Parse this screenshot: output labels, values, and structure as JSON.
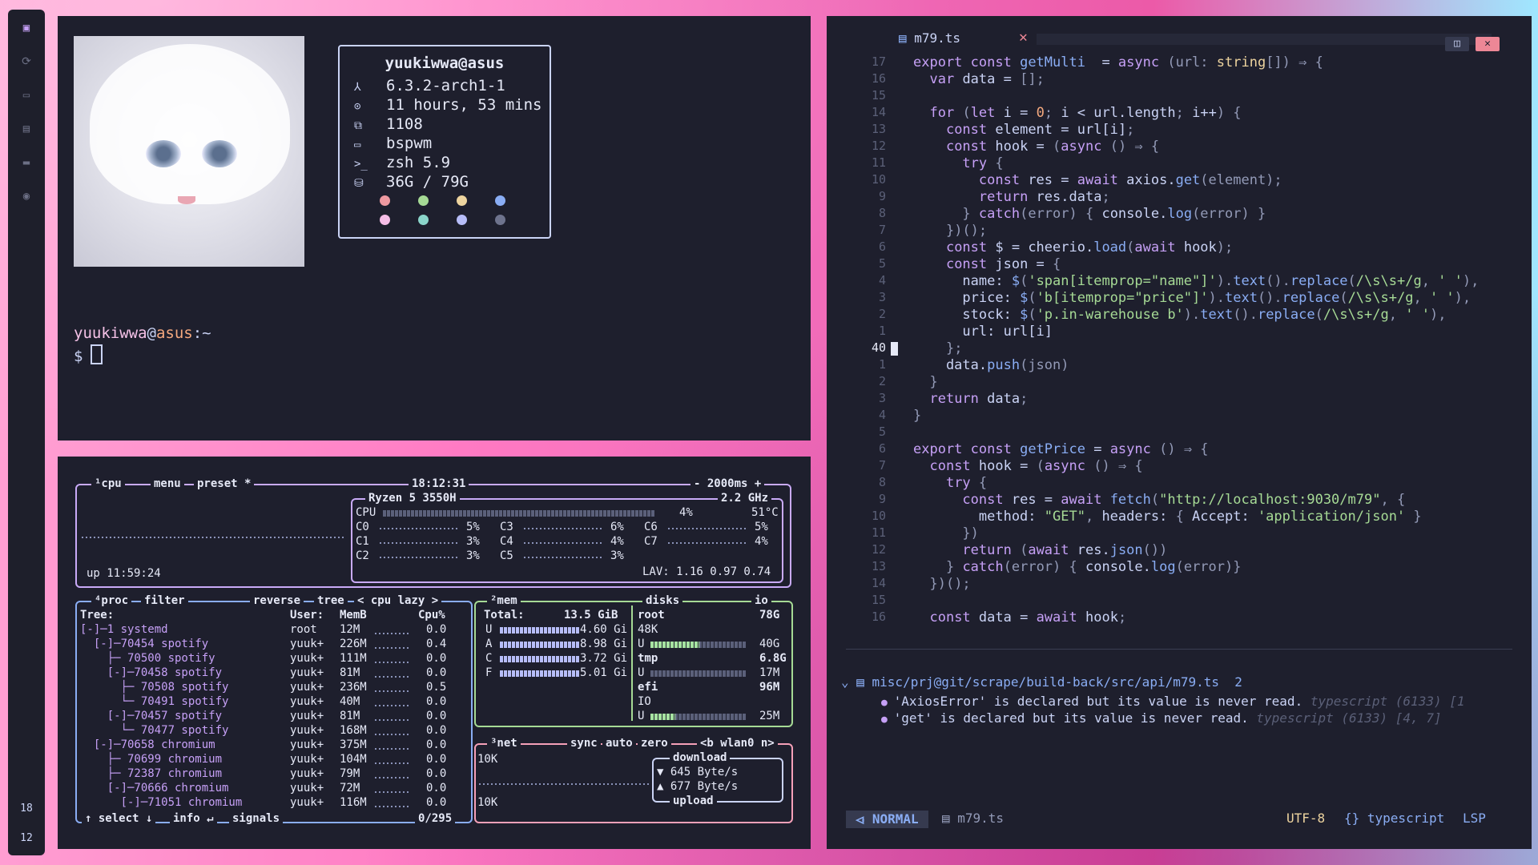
{
  "dock": {
    "workspace_top": "18",
    "workspace_bottom": "12"
  },
  "terminal": {
    "fetch_user": "yuukiwwa@asus",
    "fetch_rows": [
      {
        "icon": "arch-icon",
        "glyph": "⅄",
        "value": "6.3.2-arch1-1"
      },
      {
        "icon": "clock-icon",
        "glyph": "⊙",
        "value": "11 hours, 53 mins"
      },
      {
        "icon": "package-icon",
        "glyph": "⧉",
        "value": "1108"
      },
      {
        "icon": "window-icon",
        "glyph": "▭",
        "value": "bspwm"
      },
      {
        "icon": "shell-icon",
        "glyph": ">_",
        "value": "zsh 5.9"
      },
      {
        "icon": "disk-icon",
        "glyph": "⛁",
        "value": "36G / 79G"
      }
    ],
    "palette": [
      "#ee99a0",
      "#a6da95",
      "#eed49f",
      "#8aadf4",
      "#f5bde6",
      "#8bd5ca",
      "#b7bdf8",
      "#6e738d"
    ],
    "prompt_user": "yuukiwwa",
    "prompt_at": "@",
    "prompt_host": "asus",
    "prompt_path": ":~",
    "prompt_symbol": "$"
  },
  "btop": {
    "cpu_box": {
      "tab_cpu": "¹cpu",
      "menu": "menu",
      "preset": "preset *",
      "clock": "18:12:31",
      "interval": "- 2000ms +",
      "model": "Ryzen 5 3550H",
      "freq": "2.2 GHz",
      "uptime": "up 11:59:24",
      "cpu_total": {
        "label": "CPU",
        "pct": "4%",
        "temp": "51°C"
      },
      "cores": [
        {
          "name": "C0",
          "pct": "5%"
        },
        {
          "name": "C3",
          "pct": "6%"
        },
        {
          "name": "C6",
          "pct": "5%"
        },
        {
          "name": "C1",
          "pct": "3%"
        },
        {
          "name": "C4",
          "pct": "4%"
        },
        {
          "name": "C7",
          "pct": "4%"
        },
        {
          "name": "C2",
          "pct": "3%"
        },
        {
          "name": "C5",
          "pct": "3%"
        }
      ],
      "lav": "LAV: 1.16 0.97 0.74"
    },
    "proc": {
      "header_tabs": "⁴proc",
      "filter": "filter",
      "reverse": "reverse",
      "tree": "tree",
      "cpu_lazy": "< cpu lazy >",
      "columns": [
        "Tree:",
        "User:",
        "MemB",
        "Cpu%"
      ],
      "rows": [
        {
          "tree": "[-]─1 systemd",
          "user": "root",
          "mem": "12M",
          "cpu": "0.0"
        },
        {
          "tree": "  [-]─70454 spotify",
          "user": "yuuk+",
          "mem": "226M",
          "cpu": "0.4"
        },
        {
          "tree": "    ├─ 70500 spotify",
          "user": "yuuk+",
          "mem": "111M",
          "cpu": "0.0"
        },
        {
          "tree": "    [-]─70458 spotify",
          "user": "yuuk+",
          "mem": "81M",
          "cpu": "0.0"
        },
        {
          "tree": "      ├─ 70508 spotify",
          "user": "yuuk+",
          "mem": "236M",
          "cpu": "0.5"
        },
        {
          "tree": "      └─ 70491 spotify",
          "user": "yuuk+",
          "mem": "40M",
          "cpu": "0.0"
        },
        {
          "tree": "    [-]─70457 spotify",
          "user": "yuuk+",
          "mem": "81M",
          "cpu": "0.0"
        },
        {
          "tree": "      └─ 70477 spotify",
          "user": "yuuk+",
          "mem": "168M",
          "cpu": "0.0"
        },
        {
          "tree": "  [-]─70658 chromium",
          "user": "yuuk+",
          "mem": "375M",
          "cpu": "0.0"
        },
        {
          "tree": "    ├─ 70699 chromium",
          "user": "yuuk+",
          "mem": "104M",
          "cpu": "0.0"
        },
        {
          "tree": "    ├─ 72387 chromium",
          "user": "yuuk+",
          "mem": "79M",
          "cpu": "0.0"
        },
        {
          "tree": "    [-]─70666 chromium",
          "user": "yuuk+",
          "mem": "72M",
          "cpu": "0.0"
        },
        {
          "tree": "      [-]─71051 chromium",
          "user": "yuuk+",
          "mem": "116M",
          "cpu": "0.0"
        }
      ],
      "footer_select": "↑ select ↓",
      "footer_info": "info ↵",
      "footer_signals": "signals",
      "count": "0/295"
    },
    "mem": {
      "tab": "²mem",
      "total_label": "Total:",
      "total": "13.5 GiB",
      "rows": [
        {
          "k": "U",
          "v": "4.60 Gi"
        },
        {
          "k": "A",
          "v": "8.98 Gi"
        },
        {
          "k": "C",
          "v": "3.72 Gi"
        },
        {
          "k": "F",
          "v": "5.01 Gi"
        }
      ]
    },
    "disks": {
      "tab": "disks",
      "io": "io",
      "root": {
        "name": "root",
        "size": "78G",
        "io": "48K",
        "used": "40G",
        "used_frac": 0.51
      },
      "tmp": {
        "name": "tmp",
        "size": "6.8G",
        "used": "17M",
        "used_frac": 0.0
      },
      "efi": {
        "name": "efi",
        "size": "96M",
        "io": "IO",
        "used": "25M",
        "used_frac": 0.26
      }
    },
    "net": {
      "tab": "³net",
      "sync": "sync",
      "auto": "auto",
      "zero": "zero",
      "iface": "<b wlan0 n>",
      "top_scale": "10K",
      "bottom_scale": "10K",
      "download_label": "download",
      "download": "▼ 645 Byte/s",
      "upload": "▲ 677 Byte/s",
      "upload_label": "upload"
    }
  },
  "nvim": {
    "tab_name": "m79.ts",
    "lines": [
      {
        "n": "17",
        "t": [
          [
            "kw",
            "export "
          ],
          [
            "kw",
            "const "
          ],
          [
            "fn",
            "getMulti"
          ],
          [
            "",
            "  = "
          ],
          [
            "kw",
            "async "
          ],
          [
            "pun",
            "(url: "
          ],
          [
            "ty",
            "string"
          ],
          [
            "pun",
            "[]) ⇒ {"
          ]
        ]
      },
      {
        "n": "16",
        "t": [
          [
            "",
            "  "
          ],
          [
            "kw",
            "var "
          ],
          [
            "",
            "data = "
          ],
          [
            "pun",
            "[];"
          ]
        ]
      },
      {
        "n": "15",
        "t": []
      },
      {
        "n": "14",
        "t": [
          [
            "",
            "  "
          ],
          [
            "kw",
            "for "
          ],
          [
            "pun",
            "("
          ],
          [
            "kw",
            "let "
          ],
          [
            "",
            "i = "
          ],
          [
            "num2",
            "0"
          ],
          [
            "pun",
            "; "
          ],
          [
            "",
            "i < url.length"
          ],
          [
            "pun",
            "; "
          ],
          [
            "",
            "i++"
          ],
          [
            "pun",
            ") {"
          ]
        ]
      },
      {
        "n": "13",
        "t": [
          [
            "",
            "    "
          ],
          [
            "kw",
            "const "
          ],
          [
            "",
            "element = url[i]"
          ],
          [
            "pun",
            ";"
          ]
        ]
      },
      {
        "n": "12",
        "t": [
          [
            "",
            "    "
          ],
          [
            "kw",
            "const "
          ],
          [
            "",
            "hook = "
          ],
          [
            "pun",
            "("
          ],
          [
            "kw",
            "async "
          ],
          [
            "pun",
            "() ⇒ {"
          ]
        ]
      },
      {
        "n": "11",
        "t": [
          [
            "",
            "      "
          ],
          [
            "kw",
            "try "
          ],
          [
            "pun",
            "{"
          ]
        ]
      },
      {
        "n": "10",
        "t": [
          [
            "",
            "        "
          ],
          [
            "kw",
            "const "
          ],
          [
            "",
            "res = "
          ],
          [
            "kw",
            "await "
          ],
          [
            "",
            "axios."
          ],
          [
            "fn",
            "get"
          ],
          [
            "pun",
            "(element);"
          ]
        ]
      },
      {
        "n": "9",
        "t": [
          [
            "",
            "        "
          ],
          [
            "kw",
            "return "
          ],
          [
            "",
            "res.data"
          ],
          [
            "pun",
            ";"
          ]
        ]
      },
      {
        "n": "8",
        "t": [
          [
            "",
            "      "
          ],
          [
            "pun",
            "} "
          ],
          [
            "kw",
            "catch"
          ],
          [
            "pun",
            "(error) { "
          ],
          [
            "",
            "console."
          ],
          [
            "fn",
            "log"
          ],
          [
            "pun",
            "(error) }"
          ]
        ]
      },
      {
        "n": "7",
        "t": [
          [
            "",
            "    "
          ],
          [
            "pun",
            "})();"
          ]
        ]
      },
      {
        "n": "6",
        "t": [
          [
            "",
            "    "
          ],
          [
            "kw",
            "const "
          ],
          [
            "",
            "$ = cheerio."
          ],
          [
            "fn",
            "load"
          ],
          [
            "pun",
            "("
          ],
          [
            "kw",
            "await "
          ],
          [
            "",
            "hook"
          ],
          [
            "pun",
            ");"
          ]
        ]
      },
      {
        "n": "5",
        "t": [
          [
            "",
            "    "
          ],
          [
            "kw",
            "const "
          ],
          [
            "",
            "json = "
          ],
          [
            "pun",
            "{"
          ]
        ]
      },
      {
        "n": "4",
        "t": [
          [
            "",
            "      name: "
          ],
          [
            "fn",
            "$"
          ],
          [
            "pun",
            "("
          ],
          [
            "str",
            "'span[itemprop=\"name\"]'"
          ],
          [
            "pun",
            ")."
          ],
          [
            "fn",
            "text"
          ],
          [
            "pun",
            "()."
          ],
          [
            "fn",
            "replace"
          ],
          [
            "pun",
            "("
          ],
          [
            "str",
            "/\\s\\s+/g"
          ],
          [
            "pun",
            ", "
          ],
          [
            "str",
            "' '"
          ],
          [
            "pun",
            "),"
          ]
        ]
      },
      {
        "n": "3",
        "t": [
          [
            "",
            "      price: "
          ],
          [
            "fn",
            "$"
          ],
          [
            "pun",
            "("
          ],
          [
            "str",
            "'b[itemprop=\"price\"]'"
          ],
          [
            "pun",
            ")."
          ],
          [
            "fn",
            "text"
          ],
          [
            "pun",
            "()."
          ],
          [
            "fn",
            "replace"
          ],
          [
            "pun",
            "("
          ],
          [
            "str",
            "/\\s\\s+/g"
          ],
          [
            "pun",
            ", "
          ],
          [
            "str",
            "' '"
          ],
          [
            "pun",
            "),"
          ]
        ]
      },
      {
        "n": "2",
        "t": [
          [
            "",
            "      stock: "
          ],
          [
            "fn",
            "$"
          ],
          [
            "pun",
            "("
          ],
          [
            "str",
            "'p.in-warehouse b'"
          ],
          [
            "pun",
            ")."
          ],
          [
            "fn",
            "text"
          ],
          [
            "pun",
            "()."
          ],
          [
            "fn",
            "replace"
          ],
          [
            "pun",
            "("
          ],
          [
            "str",
            "/\\s\\s+/g"
          ],
          [
            "pun",
            ", "
          ],
          [
            "str",
            "' '"
          ],
          [
            "pun",
            "),"
          ]
        ]
      },
      {
        "n": "1",
        "t": [
          [
            "",
            "      url: url[i]"
          ]
        ]
      },
      {
        "n": "40",
        "cur": true,
        "t": [
          [
            "",
            "    "
          ],
          [
            "pun",
            "};"
          ]
        ]
      },
      {
        "n": "1",
        "t": [
          [
            "",
            "    data."
          ],
          [
            "fn",
            "push"
          ],
          [
            "pun",
            "(json)"
          ]
        ]
      },
      {
        "n": "2",
        "t": [
          [
            "",
            "  "
          ],
          [
            "pun",
            "}"
          ]
        ]
      },
      {
        "n": "3",
        "t": [
          [
            "",
            "  "
          ],
          [
            "kw",
            "return "
          ],
          [
            "",
            "data"
          ],
          [
            "pun",
            ";"
          ]
        ]
      },
      {
        "n": "4",
        "t": [
          [
            "pun",
            "}"
          ]
        ]
      },
      {
        "n": "5",
        "t": []
      },
      {
        "n": "6",
        "t": [
          [
            "kw",
            "export "
          ],
          [
            "kw",
            "const "
          ],
          [
            "fn",
            "getPrice"
          ],
          [
            "",
            "",
            " = "
          ],
          [
            "kw",
            "async "
          ],
          [
            "pun",
            "() ⇒ {"
          ]
        ]
      },
      {
        "n": "7",
        "t": [
          [
            "",
            "  "
          ],
          [
            "kw",
            "const "
          ],
          [
            "",
            "hook = "
          ],
          [
            "pun",
            "("
          ],
          [
            "kw",
            "async "
          ],
          [
            "pun",
            "() ⇒ {"
          ]
        ]
      },
      {
        "n": "8",
        "t": [
          [
            "",
            "    "
          ],
          [
            "kw",
            "try "
          ],
          [
            "pun",
            "{"
          ]
        ]
      },
      {
        "n": "9",
        "t": [
          [
            "",
            "      "
          ],
          [
            "kw",
            "const "
          ],
          [
            "",
            "res = "
          ],
          [
            "kw",
            "await "
          ],
          [
            "fn",
            "fetch"
          ],
          [
            "pun",
            "("
          ],
          [
            "str",
            "\"http://localhost:9030/m79\""
          ],
          [
            "pun",
            ", {"
          ]
        ]
      },
      {
        "n": "10",
        "t": [
          [
            "",
            "        method: "
          ],
          [
            "str",
            "\"GET\""
          ],
          [
            "pun",
            ", "
          ],
          [
            "",
            "headers: "
          ],
          [
            "pun",
            "{ "
          ],
          [
            "",
            "Accept: "
          ],
          [
            "str",
            "'application/json'"
          ],
          [
            "pun",
            " }"
          ]
        ]
      },
      {
        "n": "11",
        "t": [
          [
            "",
            "      "
          ],
          [
            "pun",
            "})"
          ]
        ]
      },
      {
        "n": "12",
        "t": [
          [
            "",
            "      "
          ],
          [
            "kw",
            "return "
          ],
          [
            "pun",
            "("
          ],
          [
            "kw",
            "await "
          ],
          [
            "",
            "res."
          ],
          [
            "fn",
            "json"
          ],
          [
            "pun",
            "())"
          ]
        ]
      },
      {
        "n": "13",
        "t": [
          [
            "",
            "    "
          ],
          [
            "pun",
            "} "
          ],
          [
            "kw",
            "catch"
          ],
          [
            "pun",
            "(error) { "
          ],
          [
            "",
            "console."
          ],
          [
            "fn",
            "log"
          ],
          [
            "pun",
            "(error)}"
          ]
        ]
      },
      {
        "n": "14",
        "t": [
          [
            "",
            "  "
          ],
          [
            "pun",
            "})();"
          ]
        ]
      },
      {
        "n": "15",
        "t": []
      },
      {
        "n": "16",
        "t": [
          [
            "",
            "  "
          ],
          [
            "kw",
            "const "
          ],
          [
            "",
            "data = "
          ],
          [
            "kw",
            "await "
          ],
          [
            "",
            "hook"
          ],
          [
            "pun",
            ";"
          ]
        ]
      }
    ],
    "diag_file": "⌄ ▤ misc/prj@git/scrape/build-back/src/api/m79.ts  2",
    "diags": [
      {
        "msg": "'AxiosError' is declared but its value is never read.",
        "src": "typescript (6133) [1"
      },
      {
        "msg": "'get' is declared but its value is never read.",
        "src": "typescript (6133) [4, 7]"
      }
    ],
    "status": {
      "mode": "⏿ NORMAL",
      "file": "▤ m79.ts",
      "encoding": "UTF-8",
      "ft": "{} typescript",
      "lsp": "LSP"
    }
  }
}
